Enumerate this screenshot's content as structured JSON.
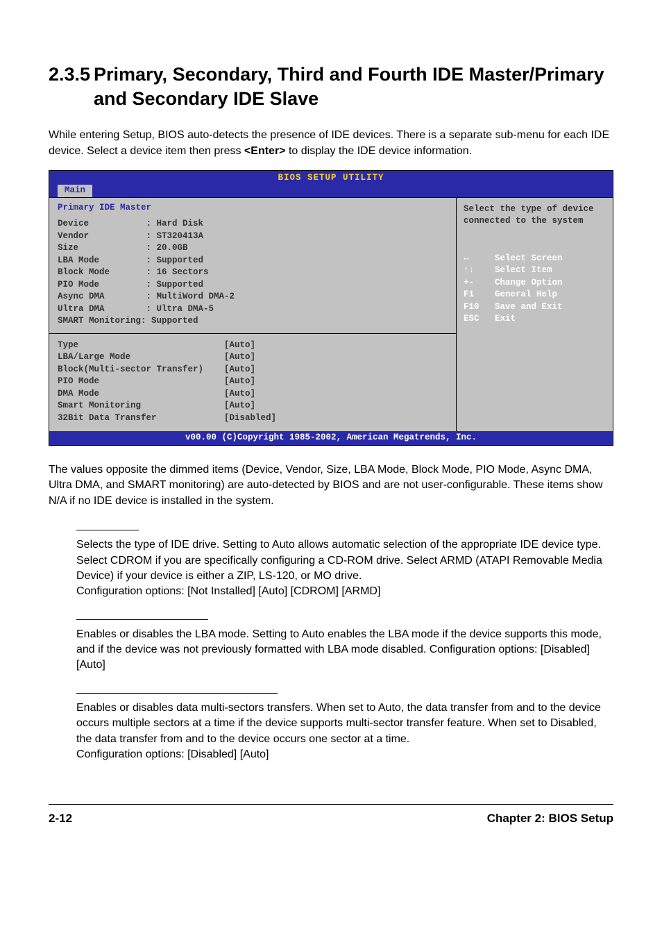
{
  "heading": {
    "number": "2.3.5",
    "title": "Primary, Secondary, Third and Fourth IDE Master/Primary and Secondary IDE Slave"
  },
  "intro": "While entering Setup, BIOS auto-detects the presence of IDE devices. There is a separate sub-menu for each IDE device. Select a device item then press <Enter> to display the IDE device information.",
  "bios": {
    "title": "BIOS SETUP UTILITY",
    "tab": "Main",
    "section_title": "Primary IDE Master",
    "info_rows": [
      "Device           : Hard Disk",
      "Vendor           : ST320413A",
      "Size             : 20.0GB",
      "LBA Mode         : Supported",
      "Block Mode       : 16 Sectors",
      "PIO Mode         : Supported",
      "Async DMA        : MultiWord DMA-2",
      "Ultra DMA        : Ultra DMA-5",
      "SMART Monitoring: Supported"
    ],
    "settings": [
      {
        "label": "Type",
        "value": "[Auto]"
      },
      {
        "label": "LBA/Large Mode",
        "value": "[Auto]"
      },
      {
        "label": "Block(Multi-sector Transfer)",
        "value": "[Auto]"
      },
      {
        "label": "PIO Mode",
        "value": "[Auto]"
      },
      {
        "label": "DMA Mode",
        "value": "[Auto]"
      },
      {
        "label": "Smart Monitoring",
        "value": "[Auto]"
      },
      {
        "label": "32Bit Data Transfer",
        "value": "[Disabled]"
      }
    ],
    "help_text": "Select the type of device connected to the system",
    "keys": [
      {
        "key": "↔",
        "action": "Select Screen"
      },
      {
        "key": "↑↓",
        "action": "Select Item"
      },
      {
        "key": "+-",
        "action": "Change Option"
      },
      {
        "key": "F1",
        "action": "General Help"
      },
      {
        "key": "F10",
        "action": "Save and Exit"
      },
      {
        "key": "ESC",
        "action": "Exit"
      }
    ],
    "footer": "v00.00 (C)Copyright 1985-2002, American Megatrends, Inc."
  },
  "body_text": "The values opposite the dimmed items (Device, Vendor, Size, LBA Mode, Block Mode, PIO Mode, Async DMA, Ultra DMA, and SMART monitoring) are auto-detected by BIOS and are not user-configurable. These items show N/A if no IDE device is installed in the system.",
  "terms": [
    {
      "width_class": "w1",
      "text": "Selects the type of IDE drive. Setting to Auto allows automatic selection of the appropriate IDE device type. Select CDROM if you are specifically configuring a CD-ROM drive. Select ARMD (ATAPI Removable Media Device) if your device is either a ZIP, LS-120, or MO drive.",
      "config": "Configuration options: [Not Installed] [Auto] [CDROM] [ARMD]"
    },
    {
      "width_class": "w2",
      "text": "Enables or disables the LBA mode. Setting to Auto enables the LBA mode if the device supports this mode, and if the device was not previously formatted with LBA mode disabled. Configuration options: [Disabled] [Auto]",
      "config": ""
    },
    {
      "width_class": "w3",
      "text": "Enables or disables data multi-sectors transfers. When set to Auto, the data transfer from and to the device occurs multiple sectors at a time if the device supports multi-sector transfer feature. When set to Disabled, the data transfer from and to the device occurs one sector at a time.",
      "config": "Configuration options: [Disabled] [Auto]"
    }
  ],
  "footer_left": "2-12",
  "footer_right": "Chapter 2: BIOS Setup"
}
